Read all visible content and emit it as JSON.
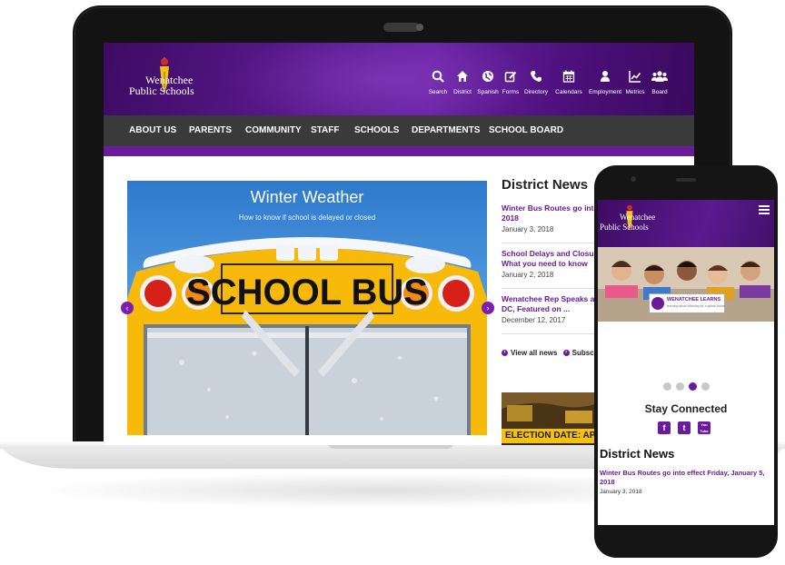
{
  "site": {
    "logo_line1": "Wenatchee",
    "logo_line2": "Public Schools"
  },
  "utility_nav": [
    {
      "label": "Search",
      "icon": "search-icon"
    },
    {
      "label": "District",
      "icon": "home-icon"
    },
    {
      "label": "Spanish",
      "icon": "globe-icon"
    },
    {
      "label": "Forms",
      "icon": "edit-icon"
    },
    {
      "label": "Directory",
      "icon": "phone-icon"
    },
    {
      "label": "Calendars",
      "icon": "calendar-icon"
    },
    {
      "label": "Employment",
      "icon": "person-icon"
    },
    {
      "label": "Metrics",
      "icon": "chart-icon"
    },
    {
      "label": "Board",
      "icon": "group-icon"
    }
  ],
  "main_nav": [
    "ABOUT US",
    "PARENTS",
    "COMMUNITY",
    "STAFF",
    "SCHOOLS",
    "DEPARTMENTS",
    "SCHOOL BOARD"
  ],
  "hero": {
    "title": "Winter Weather",
    "subtitle": "How to know if school is delayed or closed",
    "bus_sign": "SCHOOL BUS"
  },
  "news": {
    "title": "District News",
    "items": [
      {
        "headline": "Winter Bus Routes go into effect Friday, January 5, 2018",
        "date": "January 3, 2018"
      },
      {
        "headline": "School Delays and Closures for Winter Weather: What you need to know",
        "date": "January 2, 2018"
      },
      {
        "headline": "Wenatchee Rep Speaks at Congressional Briefing in DC, Featured on ...",
        "date": "December 12, 2017"
      }
    ],
    "view_all": "View all news",
    "subscribe": "Subscribe",
    "election_text": "ELECTION DATE: APRIL"
  },
  "mobile": {
    "logo_line1": "Wenatchee",
    "logo_line2": "Public Schools",
    "badge_text": "WENATCHEE LEARNS",
    "badge_sub": "learning about learning for a global future",
    "stay_connected": "Stay Connected",
    "social": [
      "f",
      "t",
      "You Tube"
    ],
    "news_title": "District News",
    "news_headline": "Winter Bus Routes go into effect Friday, January 5, 2018",
    "news_date": "January 3, 2018"
  },
  "colors": {
    "brand_purple": "#6a1b9a",
    "nav_gray": "#3a3a3a",
    "bus_yellow": "#f7b90a"
  }
}
